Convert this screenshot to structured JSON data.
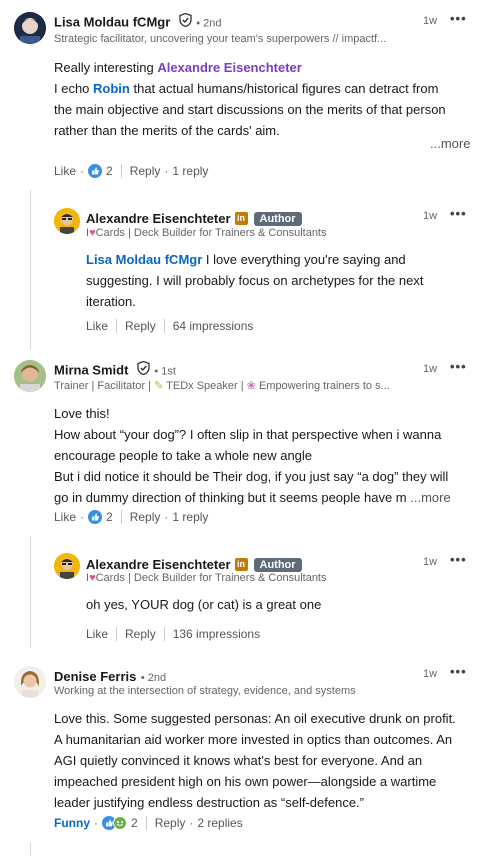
{
  "comments": [
    {
      "name": "Lisa Moldau fCMgr",
      "degree": "• 2nd",
      "headline": "Strategic facilitator, uncovering your team's superpowers // impactf...",
      "time": "1w",
      "line1_prefix": "Really interesting ",
      "line1_mention": "Alexandre Eisenchteter",
      "line2_prefix": "I echo ",
      "line2_mention": "Robin",
      "line2_rest": " that actual humans/historical figures can detract from",
      "line3": "the main objective and start discussions on the merits of that person",
      "line4": "rather than the merits of the cards' aim.",
      "more": "...more",
      "like": "Like",
      "reaction_count": "2",
      "reply": "Reply",
      "replies": "1 reply"
    },
    {
      "name": "Alexandre Eisenchteter",
      "author_badge": "Author",
      "headline_prefix": "I",
      "headline": "Cards | Deck Builder for Trainers & Consultants",
      "time": "1w",
      "mention": "Lisa Moldau fCMgr",
      "line1_rest": " I love everything you're saying and",
      "line2": "suggesting. I will probably focus on archetypes for the next",
      "line3": "iteration.",
      "like": "Like",
      "reply": "Reply",
      "impressions": "64 impressions"
    },
    {
      "name": "Mirna Smidt",
      "degree": "• 1st",
      "headline_a": "Trainer | Facilitator |",
      "headline_b": "TEDx Speaker |",
      "headline_c": "Empowering trainers to s...",
      "time": "1w",
      "line1": "Love this!",
      "line2": "How about “your dog”? I often slip in that perspective when i wanna",
      "line3": "encourage people to take a whole new angle",
      "line4": "But i did notice it should be Their dog, if you just say “a dog” they will",
      "line5": "go in dummy direction of thinking but it seems people have m",
      "more": "...more",
      "like": "Like",
      "reaction_count": "2",
      "reply": "Reply",
      "replies": "1 reply"
    },
    {
      "name": "Alexandre Eisenchteter",
      "author_badge": "Author",
      "headline_prefix": "I",
      "headline": "Cards | Deck Builder for Trainers & Consultants",
      "time": "1w",
      "line1": "oh yes, YOUR dog (or cat) is a great one",
      "like": "Like",
      "reply": "Reply",
      "impressions": "136 impressions"
    },
    {
      "name": "Denise Ferris",
      "degree": "• 2nd",
      "headline": "Working at the intersection of strategy, evidence, and systems",
      "time": "1w",
      "line1": "Love this. Some suggested personas: An oil executive drunk on profit.",
      "line2": "A humanitarian aid worker more invested in optics than outcomes. An",
      "line3": "AGI quietly convinced it knows what's best for everyone. And an",
      "line4": "impeached president high on his own power—alongside a wartime",
      "line5": "leader justifying endless destruction as “self-defence.”",
      "like": "Funny",
      "reaction_count": "2",
      "reply": "Reply",
      "replies": "2 replies"
    }
  ],
  "icons": {
    "more": "more-options-icon",
    "verified": "verified-shield-icon",
    "like_reaction": "like-reaction-icon",
    "heart": "heart-icon",
    "linkedin_premium": "linkedin-premium-icon"
  },
  "colors": {
    "link_blue": "#0a66c2",
    "mention_purple": "#7a3dc7",
    "funny_blue": "#0a66c2"
  }
}
